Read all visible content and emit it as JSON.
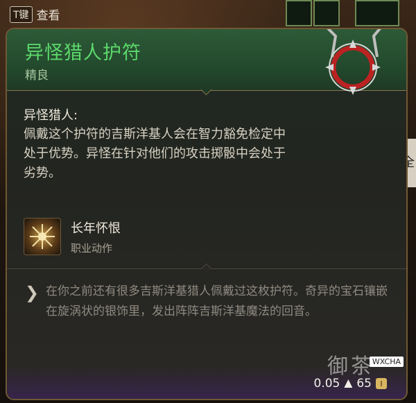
{
  "hud": {
    "key_label": "T键",
    "inspect_label": "查看",
    "right_edge_char": "全"
  },
  "item": {
    "name": "异怪猎人护符",
    "rarity": "精良"
  },
  "ability": {
    "title": "异怪猎人:",
    "description": "佩戴这个护符的吉斯洋基人会在智力豁免检定中处于优势。异怪在针对他们的攻击掷骰中会处于劣势。"
  },
  "action": {
    "name": "长年怀恨",
    "type": "职业动作",
    "icon": "crossed-blades-icon"
  },
  "flavor": {
    "text": "在你之前还有很多吉斯洋基猎人佩戴过这枚护符。奇异的宝石镶嵌在旋涡状的银饰里，发出阵阵吉斯洋基魔法的回音。"
  },
  "stats": {
    "weight": "0.05",
    "value": "65"
  },
  "watermark": {
    "text": "御茶",
    "tag": "WXCHA"
  },
  "colors": {
    "name_green": "#5cd86b",
    "header_bg": "#2d5a38",
    "border_gold": "#6e5a36"
  }
}
